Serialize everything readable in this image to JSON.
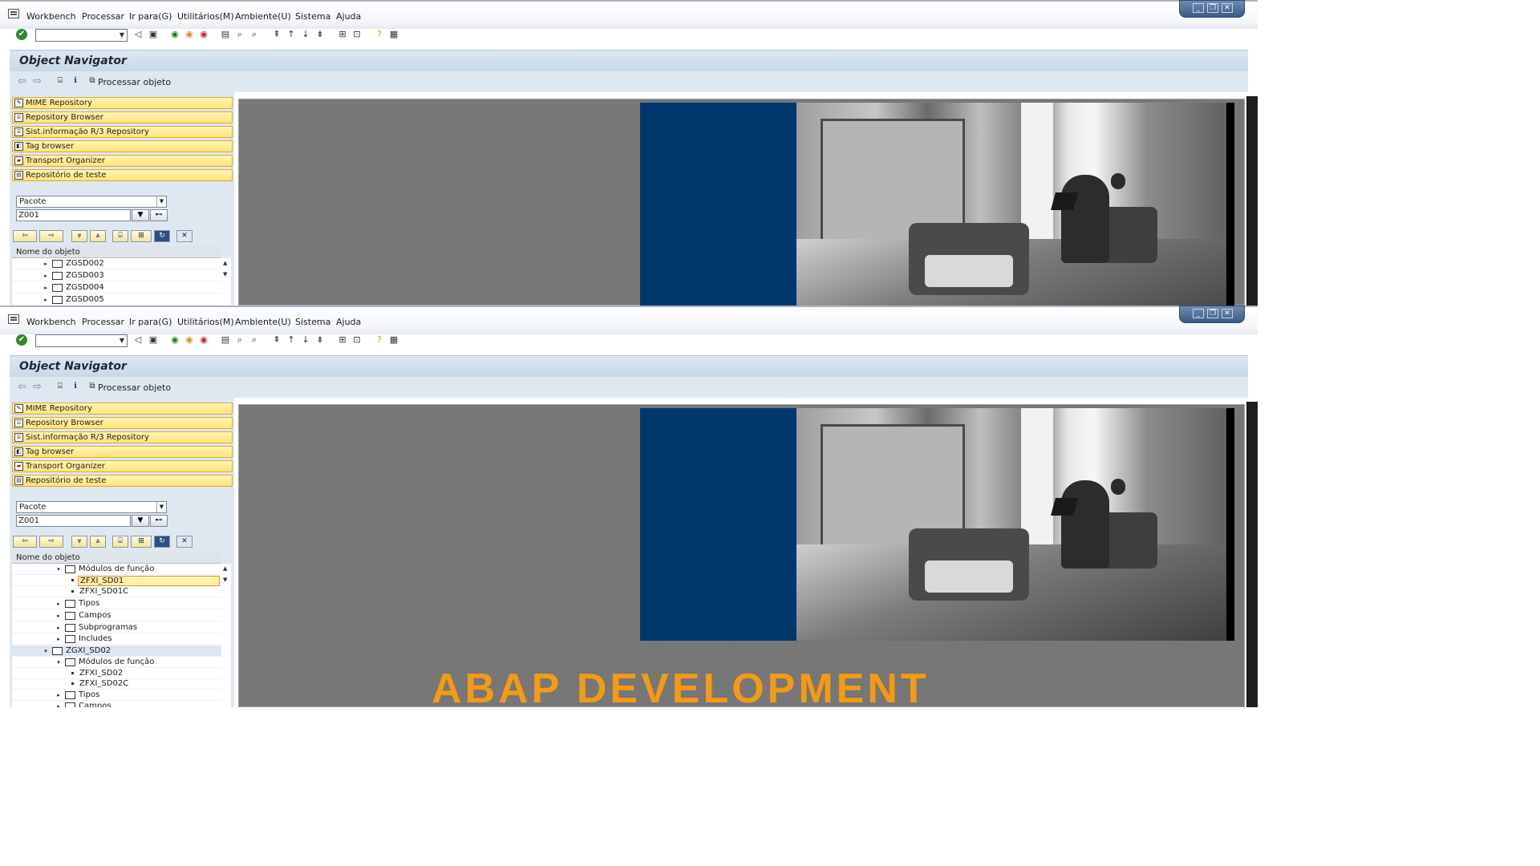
{
  "menu": {
    "items": [
      "Workbench",
      "Processar",
      "Ir para(G)",
      "Utilitários(M)",
      "Ambiente(U)",
      "Sistema",
      "Ajuda"
    ]
  },
  "window_buttons": {
    "minimize": "_",
    "restore": "❐",
    "close": "✕"
  },
  "title": "Object Navigator",
  "app_toolbar": {
    "process_object": "Processar objeto"
  },
  "left_buttons": [
    "MIME Repository",
    "Repository Browser",
    "Sist.informação R/3 Repository",
    "Tag browser",
    "Transport Organizer",
    "Repositório de teste"
  ],
  "selector": {
    "type": "Pacote",
    "value": "Z001"
  },
  "tree": {
    "header": "Nome do objeto",
    "window1_rows": [
      {
        "label": "ZGSD002",
        "level": 0,
        "expanded": false
      },
      {
        "label": "ZGSD003",
        "level": 0,
        "expanded": false
      },
      {
        "label": "ZGSD004",
        "level": 0,
        "expanded": false
      },
      {
        "label": "ZGSD005",
        "level": 0,
        "expanded": false
      }
    ],
    "window2_rows": [
      {
        "label": "Módulos de função",
        "level": 1,
        "expanded": true,
        "kind": "folder"
      },
      {
        "label": "ZFXI_SD01",
        "level": 2,
        "kind": "item",
        "selected": true
      },
      {
        "label": "ZFXI_SD01C",
        "level": 2,
        "kind": "item"
      },
      {
        "label": "Tipos",
        "level": 1,
        "expanded": false,
        "kind": "folder"
      },
      {
        "label": "Campos",
        "level": 1,
        "expanded": false,
        "kind": "folder"
      },
      {
        "label": "Subprogramas",
        "level": 1,
        "expanded": false,
        "kind": "folder"
      },
      {
        "label": "Includes",
        "level": 1,
        "expanded": false,
        "kind": "folder"
      },
      {
        "label": "ZGXI_SD02",
        "level": 0,
        "expanded": true,
        "kind": "folder"
      },
      {
        "label": "Módulos de função",
        "level": 1,
        "expanded": true,
        "kind": "folder"
      },
      {
        "label": "ZFXI_SD02",
        "level": 2,
        "kind": "item"
      },
      {
        "label": "ZFXI_SD02C",
        "level": 2,
        "kind": "item"
      },
      {
        "label": "Tipos",
        "level": 1,
        "expanded": false,
        "kind": "folder"
      },
      {
        "label": "Campos",
        "level": 1,
        "expanded": false,
        "kind": "folder"
      }
    ]
  },
  "banner": {
    "text": "ABAP DEVELOPMENT"
  },
  "colors": {
    "accent_blue": "#00386e",
    "banner_orange": "#f49a13",
    "title_bg": "#dce6f1",
    "button_yellow": "#ffe37a"
  }
}
